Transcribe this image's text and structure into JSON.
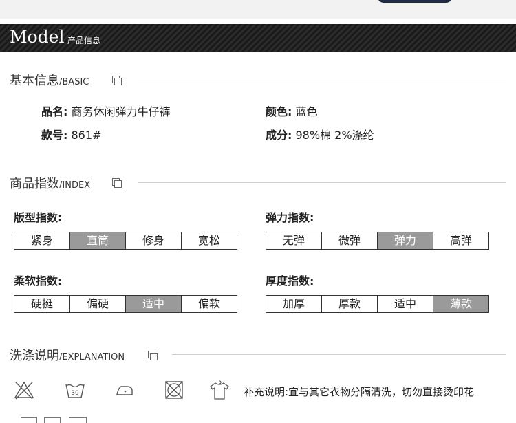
{
  "header": {
    "model": "Model",
    "sub": "产品信息"
  },
  "basic": {
    "title": "基本信息",
    "title_en": "/BASIC",
    "name_key": "品名:",
    "name_val": "商务休闲弹力牛仔裤",
    "color_key": "颜色:",
    "color_val": "蓝色",
    "style_key": "款号:",
    "style_val": "861#",
    "material_key": "成分:",
    "material_val": "98%棉 2%涤纶"
  },
  "index": {
    "title": "商品指数",
    "title_en": "/INDEX",
    "scales": [
      {
        "label": "版型指数:",
        "options": [
          "紧身",
          "直筒",
          "修身",
          "宽松"
        ],
        "selected": 1
      },
      {
        "label": "弹力指数:",
        "options": [
          "无弹",
          "微弹",
          "弹力",
          "高弹"
        ],
        "selected": 2
      },
      {
        "label": "柔软指数:",
        "options": [
          "硬挺",
          "偏硬",
          "适中",
          "偏软"
        ],
        "selected": 2
      },
      {
        "label": "厚度指数:",
        "options": [
          "加厚",
          "厚款",
          "适中",
          "薄款"
        ],
        "selected": 3
      }
    ]
  },
  "explanation": {
    "title": "洗涤说明",
    "title_en": "/EXPLANATION",
    "icons": [
      {
        "name": "do-not-bleach-icon"
      },
      {
        "name": "wash-30-icon",
        "text": "30"
      },
      {
        "name": "iron-low-icon"
      },
      {
        "name": "do-not-tumble-dry-icon"
      },
      {
        "name": "hang-dry-icon"
      }
    ],
    "note": "补充说明:宜与其它衣物分隔清洗，切勿直接烫印花"
  },
  "colors": {
    "selected_cell": "#9a9a9a",
    "header_bg": "#1a1a1a"
  }
}
